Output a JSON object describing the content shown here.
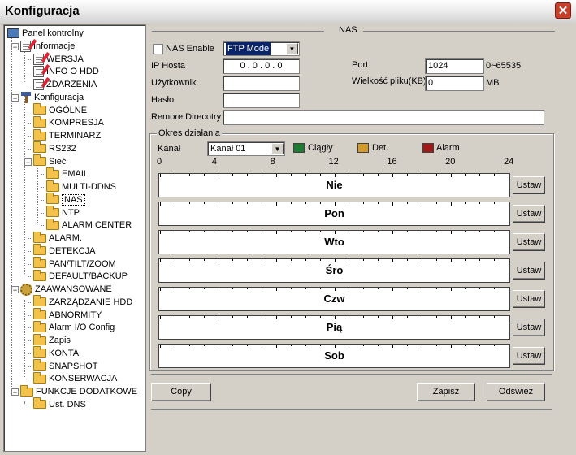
{
  "window": {
    "title": "Konfiguracja",
    "close_glyph": "✕"
  },
  "tree": [
    {
      "label": "Panel kontrolny",
      "icon": "monitor-icon"
    },
    {
      "label": "Informacje",
      "icon": "document-icon"
    },
    {
      "label": "WERSJA",
      "icon": "document-icon"
    },
    {
      "label": "INFO O HDD",
      "icon": "document-icon"
    },
    {
      "label": "ZDARZENIA",
      "icon": "document-icon"
    },
    {
      "label": "Konfiguracja",
      "icon": "hammer-icon"
    },
    {
      "label": "OGÓLNE",
      "icon": "folder-icon"
    },
    {
      "label": "KOMPRESJA",
      "icon": "folder-icon"
    },
    {
      "label": "TERMINARZ",
      "icon": "folder-icon"
    },
    {
      "label": "RS232",
      "icon": "folder-icon"
    },
    {
      "label": "Sieć",
      "icon": "folder-icon"
    },
    {
      "label": "EMAIL",
      "icon": "folder-icon"
    },
    {
      "label": "MULTI-DDNS",
      "icon": "folder-icon"
    },
    {
      "label": "NAS",
      "icon": "folder-open-icon",
      "selected": true
    },
    {
      "label": "NTP",
      "icon": "folder-icon"
    },
    {
      "label": "ALARM CENTER",
      "icon": "folder-icon"
    },
    {
      "label": "ALARM.",
      "icon": "folder-icon"
    },
    {
      "label": "DETEKCJA",
      "icon": "folder-icon"
    },
    {
      "label": "PAN/TILT/ZOOM",
      "icon": "folder-icon"
    },
    {
      "label": "DEFAULT/BACKUP",
      "icon": "folder-icon"
    },
    {
      "label": "ZAAWANSOWANE",
      "icon": "gear-icon"
    },
    {
      "label": "ZARZĄDZANIE HDD",
      "icon": "folder-icon"
    },
    {
      "label": "ABNORMITY",
      "icon": "folder-icon"
    },
    {
      "label": "Alarm I/O Config",
      "icon": "folder-icon"
    },
    {
      "label": "Zapis",
      "icon": "folder-icon"
    },
    {
      "label": "KONTA",
      "icon": "folder-icon"
    },
    {
      "label": "SNAPSHOT",
      "icon": "folder-icon"
    },
    {
      "label": "KONSERWACJA",
      "icon": "folder-icon"
    },
    {
      "label": "FUNKCJE DODATKOWE",
      "icon": "folder-icon"
    },
    {
      "label": "Ust. DNS",
      "icon": "folder-icon"
    }
  ],
  "nas": {
    "section_title": "NAS",
    "enable_label": "NAS Enable",
    "enable_checked": false,
    "mode_value": "FTP Mode",
    "ip_label": "IP Hosta",
    "ip_value": "0 . 0 . 0 . 0",
    "port_label": "Port",
    "port_value": "1024",
    "port_range": "0~65535",
    "user_label": "Użytkownik",
    "user_value": "",
    "filesize_label": "Wielkość pliku(KB)",
    "filesize_value": "0",
    "filesize_unit": "MB",
    "password_label": "Hasło",
    "password_value": "",
    "remote_dir_label": "Remore Direcotry",
    "remote_dir_value": ""
  },
  "schedule": {
    "group_label": "Okres działania",
    "channel_label": "Kanał",
    "channel_value": "Kanał 01",
    "legend": [
      {
        "label": "Ciągły",
        "color": "#1e7a32"
      },
      {
        "label": "Det.",
        "color": "#d49a2a"
      },
      {
        "label": "Alarm",
        "color": "#a01818"
      }
    ],
    "hours": [
      "0",
      "4",
      "8",
      "12",
      "16",
      "20",
      "24"
    ],
    "days": [
      "Nie",
      "Pon",
      "Wto",
      "Śro",
      "Czw",
      "Pią",
      "Sob"
    ],
    "set_label": "Ustaw"
  },
  "buttons": {
    "copy": "Copy",
    "save": "Zapisz",
    "refresh": "Odśwież"
  }
}
